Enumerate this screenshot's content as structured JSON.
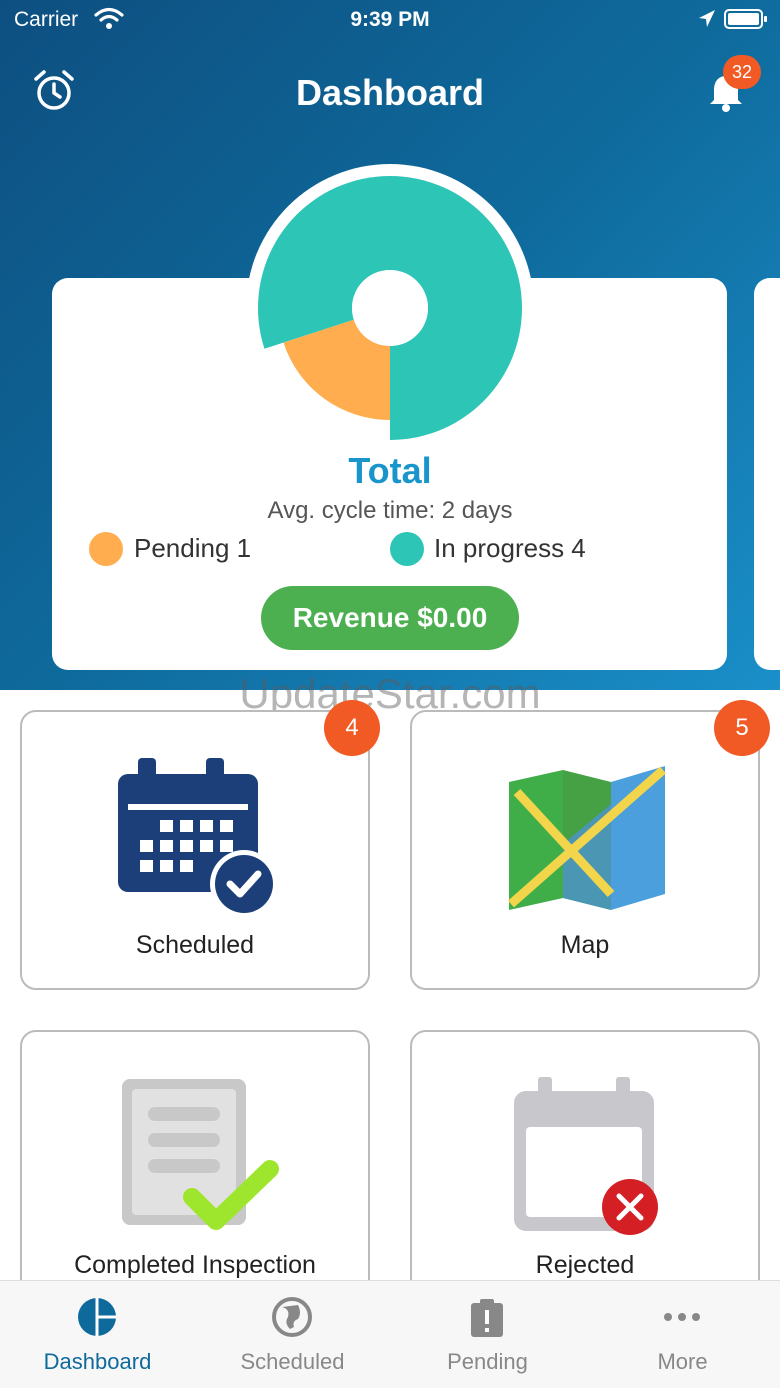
{
  "status_bar": {
    "carrier": "Carrier",
    "time": "9:39 PM"
  },
  "nav": {
    "title": "Dashboard",
    "notification_count": "32"
  },
  "summary": {
    "total_label": "Total",
    "cycle_time": "Avg. cycle time: 2 days",
    "legend": [
      {
        "label": "Pending 1",
        "color": "#ffad4f"
      },
      {
        "label": "In progress 4",
        "color": "#2dc5b6"
      }
    ],
    "revenue_label": "Revenue $0.00",
    "chart": {
      "pending": 1,
      "in_progress": 4
    }
  },
  "watermark": "UpdateStar.com",
  "tiles": [
    {
      "label": "Scheduled",
      "badge": "4"
    },
    {
      "label": "Map",
      "badge": "5"
    },
    {
      "label": "Completed Inspection",
      "badge": ""
    },
    {
      "label": "Rejected",
      "badge": ""
    }
  ],
  "tabs": [
    {
      "label": "Dashboard",
      "icon": "pie-chart-icon",
      "active": true
    },
    {
      "label": "Scheduled",
      "icon": "globe-icon"
    },
    {
      "label": "Pending",
      "icon": "clipboard-alert-icon"
    },
    {
      "label": "More",
      "icon": "more-dots-icon"
    }
  ],
  "colors": {
    "header_start": "#0d4f80",
    "header_end": "#1a8fc9",
    "accent": "#1a95cc",
    "badge": "#f15a24",
    "revenue": "#4caf50"
  }
}
